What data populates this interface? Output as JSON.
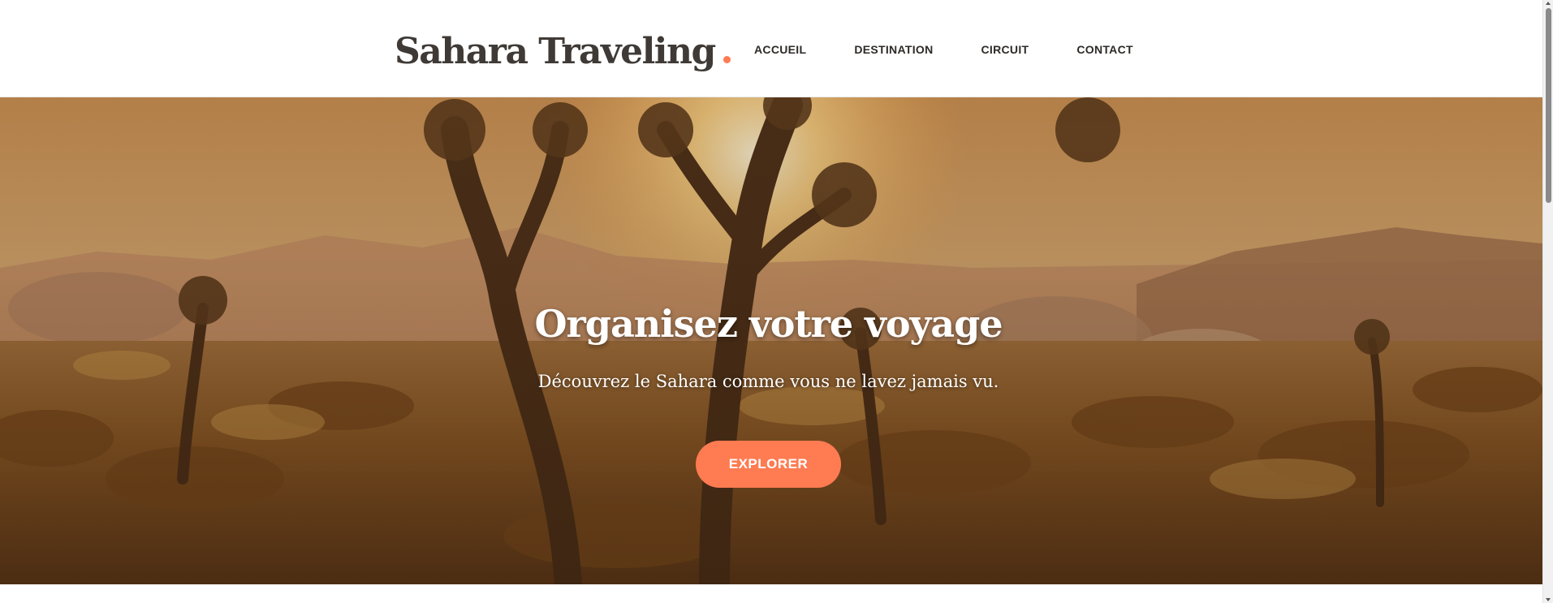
{
  "header": {
    "logo_text": "Sahara Traveling",
    "nav": [
      {
        "label": "ACCUEIL"
      },
      {
        "label": "DESTINATION"
      },
      {
        "label": "CIRCUIT"
      },
      {
        "label": "CONTACT"
      }
    ]
  },
  "hero": {
    "title": "Organisez votre voyage",
    "subtitle": "Découvrez le Sahara comme vous ne lavez jamais vu.",
    "button_label": "EXPLORER",
    "background_image": "desert-joshua-trees-sunset"
  },
  "colors": {
    "accent": "#ff7b52",
    "logo_text": "#3f3a36",
    "nav_text": "#2d2a27",
    "hero_overlay": "#5a3a1c"
  }
}
